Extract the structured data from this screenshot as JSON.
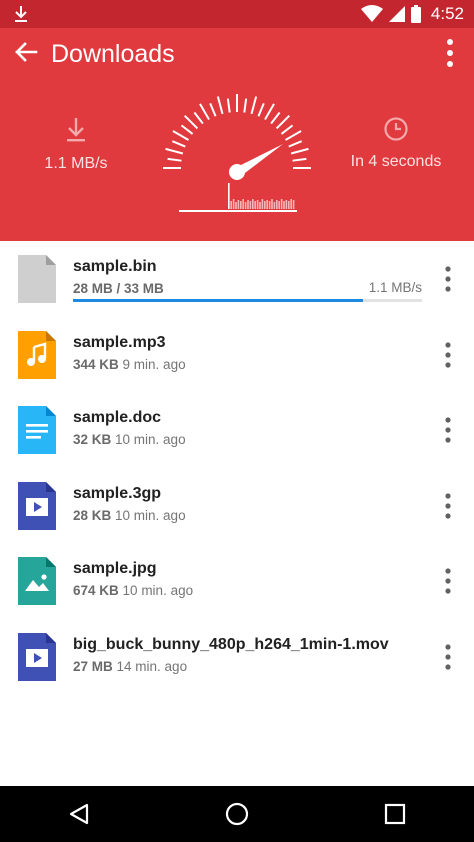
{
  "status": {
    "time": "4:52"
  },
  "header": {
    "title": "Downloads",
    "speed": "1.1 MB/s",
    "eta": "In 4 seconds"
  },
  "colors": {
    "header": "#e0393e",
    "status_bar": "#c4262f",
    "progress": "#1e88e5"
  },
  "downloads": [
    {
      "name": "sample.bin",
      "size": "28 MB / 33 MB",
      "rate": "1.1 MB/s",
      "progress": 0.83,
      "icon": "generic-file-icon"
    },
    {
      "name": "sample.mp3",
      "size": "344 KB",
      "age": "9 min. ago",
      "icon": "audio-file-icon"
    },
    {
      "name": "sample.doc",
      "size": "32 KB",
      "age": "10 min. ago",
      "icon": "document-file-icon"
    },
    {
      "name": "sample.3gp",
      "size": "28 KB",
      "age": "10 min. ago",
      "icon": "video-file-icon"
    },
    {
      "name": "sample.jpg",
      "size": "674 KB",
      "age": "10 min. ago",
      "icon": "image-file-icon"
    },
    {
      "name": "big_buck_bunny_480p_h264_1min-1.mov",
      "size": "27 MB",
      "age": "14 min. ago",
      "icon": "video-file-icon"
    }
  ]
}
